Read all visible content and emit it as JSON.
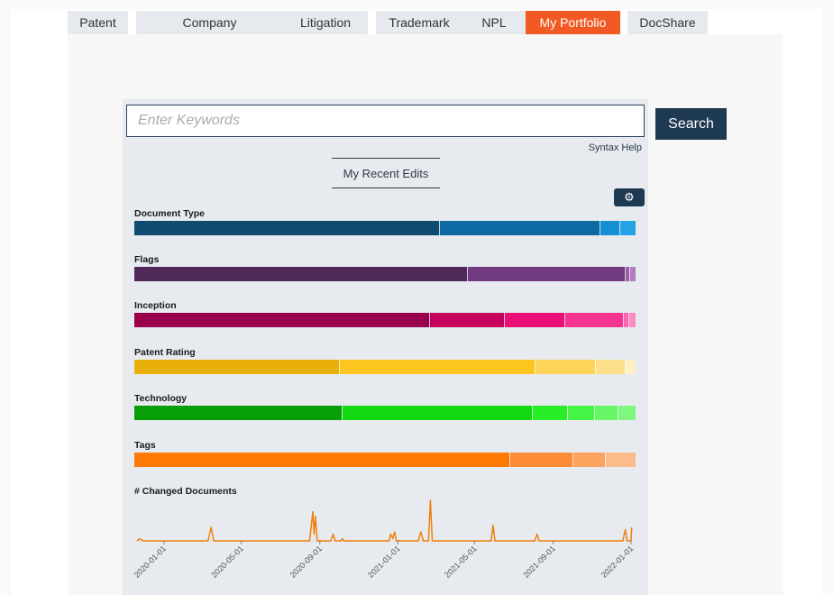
{
  "tabs": [
    {
      "label": "Patent",
      "active": false
    },
    {
      "label": "Company",
      "active": false
    },
    {
      "label": "Litigation",
      "active": false
    },
    {
      "label": "Trademark",
      "active": false
    },
    {
      "label": "NPL",
      "active": false
    },
    {
      "label": "My Portfolio",
      "active": true
    },
    {
      "label": "DocShare",
      "active": false
    }
  ],
  "search": {
    "placeholder": "Enter Keywords",
    "value": "",
    "button_label": "Search",
    "syntax_help": "Syntax Help"
  },
  "recent_edits_label": "My Recent Edits",
  "settings_icon": "gear-icon",
  "colors": {
    "active_tab": "#f15a22",
    "navy": "#1e3a52"
  },
  "facets": [
    {
      "label": "Document Type",
      "segments": [
        {
          "share": 61,
          "color": "#0f4b70"
        },
        {
          "share": 32,
          "color": "#0d6aa3"
        },
        {
          "share": 4,
          "color": "#178fd4"
        },
        {
          "share": 3,
          "color": "#24a3e8"
        }
      ]
    },
    {
      "label": "Flags",
      "segments": [
        {
          "share": 66.5,
          "color": "#4f2a58"
        },
        {
          "share": 31.5,
          "color": "#723a80"
        },
        {
          "share": 1,
          "color": "#9c5bab"
        },
        {
          "share": 1,
          "color": "#b37ec1"
        }
      ]
    },
    {
      "label": "Inception",
      "segments": [
        {
          "share": 59,
          "color": "#98004c"
        },
        {
          "share": 15,
          "color": "#c5005f"
        },
        {
          "share": 12,
          "color": "#ea0f77"
        },
        {
          "share": 11.6,
          "color": "#f53591"
        },
        {
          "share": 1.2,
          "color": "#f968ad"
        },
        {
          "share": 1.2,
          "color": "#fb8bc1"
        }
      ]
    },
    {
      "label": "Patent Rating",
      "segments": [
        {
          "share": 41,
          "color": "#e8b008"
        },
        {
          "share": 39,
          "color": "#fcc520"
        },
        {
          "share": 12,
          "color": "#fdd35a"
        },
        {
          "share": 6,
          "color": "#fee08a"
        },
        {
          "share": 2,
          "color": "#fff0c4"
        }
      ]
    },
    {
      "label": "Technology",
      "segments": [
        {
          "share": 41.5,
          "color": "#079e07"
        },
        {
          "share": 38,
          "color": "#12d912"
        },
        {
          "share": 7,
          "color": "#27ee27"
        },
        {
          "share": 5.5,
          "color": "#45f545"
        },
        {
          "share": 4.5,
          "color": "#66f766"
        },
        {
          "share": 3.5,
          "color": "#7ff77f"
        }
      ]
    },
    {
      "label": "Tags",
      "segments": [
        {
          "share": 75,
          "color": "#ff7a05"
        },
        {
          "share": 12.5,
          "color": "#fd8c36"
        },
        {
          "share": 6.5,
          "color": "#fca35f"
        },
        {
          "share": 6,
          "color": "#fcbb8a"
        }
      ]
    }
  ],
  "chart_data": {
    "type": "line",
    "title": "# Changed Documents",
    "xlabel": "",
    "ylabel": "",
    "x_ticks": [
      "2020-01-01",
      "2020-05-01",
      "2020-09-01",
      "2021-01-01",
      "2021-05-01",
      "2021-09-01",
      "2022-01-01"
    ],
    "x_range": [
      "2019-11-20",
      "2022-01-01"
    ],
    "grid": false,
    "color": "#f07f0b",
    "series": [
      {
        "values": [
          [
            "2019-11-20",
            0
          ],
          [
            "2019-11-24",
            1
          ],
          [
            "2019-11-30",
            0
          ],
          [
            "2020-03-10",
            0
          ],
          [
            "2020-03-15",
            6
          ],
          [
            "2020-03-19",
            0
          ],
          [
            "2020-08-16",
            0
          ],
          [
            "2020-08-21",
            13
          ],
          [
            "2020-08-23",
            3
          ],
          [
            "2020-08-25",
            11
          ],
          [
            "2020-08-28",
            0
          ],
          [
            "2020-09-18",
            0
          ],
          [
            "2020-09-22",
            3
          ],
          [
            "2020-09-25",
            0
          ],
          [
            "2020-10-04",
            0
          ],
          [
            "2020-10-06",
            1
          ],
          [
            "2020-10-09",
            0
          ],
          [
            "2020-12-18",
            0
          ],
          [
            "2020-12-21",
            3
          ],
          [
            "2020-12-24",
            1
          ],
          [
            "2020-12-27",
            4
          ],
          [
            "2020-12-30",
            0
          ],
          [
            "2021-02-02",
            0
          ],
          [
            "2021-02-06",
            4
          ],
          [
            "2021-02-10",
            0
          ],
          [
            "2021-02-18",
            0
          ],
          [
            "2021-02-21",
            18
          ],
          [
            "2021-02-24",
            0
          ],
          [
            "2021-05-27",
            0
          ],
          [
            "2021-05-30",
            7
          ],
          [
            "2021-06-02",
            0
          ],
          [
            "2021-08-03",
            0
          ],
          [
            "2021-08-07",
            3
          ],
          [
            "2021-08-10",
            0
          ],
          [
            "2021-12-19",
            0
          ],
          [
            "2021-12-23",
            5
          ],
          [
            "2021-12-26",
            0
          ],
          [
            "2022-01-01",
            0
          ],
          [
            "2022-01-02",
            6
          ]
        ]
      }
    ]
  }
}
